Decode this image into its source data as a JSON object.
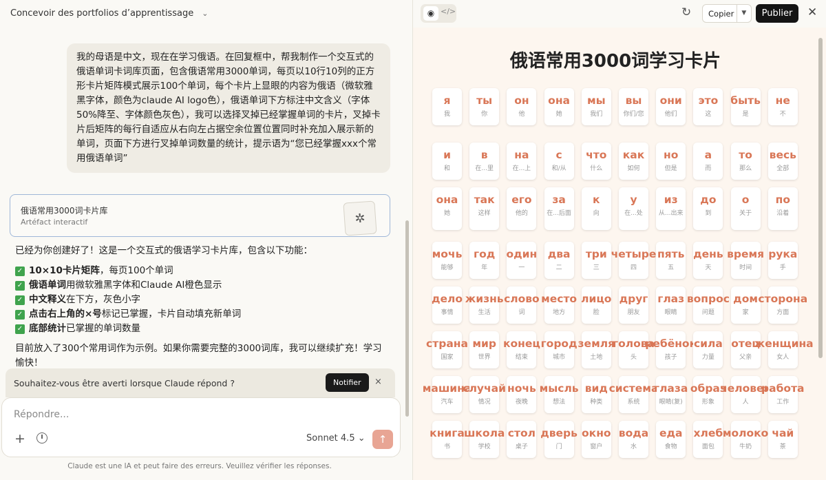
{
  "chat": {
    "title": "Concevoir des portfolios d’apprentissage",
    "user_message": "我的母语是中文，现在在学习俄语。在回复框中，帮我制作一个交互式的俄语单词卡词库页面，包含俄语常用3000单词，每页以10行10列的正方形卡片矩阵模式展示100个单词，每个卡片上显眼的内容为俄语（微软雅黑字体，颜色为claude AI logo色），俄语单词下方标注中文含义（字体50%降至、字体颜色灰色），我可以选择叉掉已经掌握单词的卡片，叉掉卡片后矩阵的每行自适应从右向左占据空余位置位置同时补充加入展示新的单词，页面下方进行叉掉单词数量的统计，提示语为“您已经掌握xxx个常用俄语单词”",
    "artifact": {
      "title": "俄语常用3000词卡片库",
      "subtitle": "Artéfact interactif"
    },
    "reply": {
      "intro": "已经为你创建好了！这是一个交互式的俄语学习卡片库，包含以下功能：",
      "features": [
        {
          "bold": "10×10卡片矩阵",
          "text": "，每页100个单词"
        },
        {
          "bold": "俄语单词",
          "text": "用微软雅黑字体和Claude AI橙色显示"
        },
        {
          "bold": "中文释义",
          "text": "在下方，灰色小字"
        },
        {
          "bold": "点击右上角的×号",
          "text": "标记已掌握，卡片自动填充新单词"
        },
        {
          "bold": "底部统计",
          "text": "已掌握的单词数量"
        }
      ],
      "tail": "目前放入了300个常用词作为示例。如果你需要完整的3000词库，我可以继续扩充！学习愉快！"
    },
    "notify": {
      "text": "Souhaitez-vous être averti lorsque Claude répond ?",
      "button": "Notifier",
      "close": "×"
    },
    "composer": {
      "placeholder": "Répondre...",
      "model": "Sonnet 4.5 ⌄",
      "send": "↑"
    },
    "disclaimer": "Claude est une IA et peut faire des erreurs. Veuillez vérifier les réponses."
  },
  "preview": {
    "copy_label": "Copier",
    "publish_label": "Publier",
    "title": "俄语常用3000词学习卡片",
    "accent_color": "#d97757",
    "rows": [
      [
        [
          "я",
          "我"
        ],
        [
          "ты",
          "你"
        ],
        [
          "он",
          "他"
        ],
        [
          "она",
          "她"
        ],
        [
          "мы",
          "我们"
        ],
        [
          "вы",
          "你们/您"
        ],
        [
          "они",
          "他们"
        ],
        [
          "это",
          "这"
        ],
        [
          "быть",
          "是"
        ],
        [
          "не",
          "不"
        ]
      ],
      [
        [
          "и",
          "和"
        ],
        [
          "в",
          "在...里"
        ],
        [
          "на",
          "在...上"
        ],
        [
          "с",
          "和/从"
        ],
        [
          "что",
          "什么"
        ],
        [
          "как",
          "如何"
        ],
        [
          "но",
          "但是"
        ],
        [
          "а",
          "而"
        ],
        [
          "то",
          "那么"
        ],
        [
          "весь",
          "全部"
        ]
      ],
      [
        [
          "она",
          "她"
        ],
        [
          "так",
          "这样"
        ],
        [
          "его",
          "他的"
        ],
        [
          "за",
          "在...后面"
        ],
        [
          "к",
          "向"
        ],
        [
          "у",
          "在...处"
        ],
        [
          "из",
          "从...出来"
        ],
        [
          "до",
          "到"
        ],
        [
          "о",
          "关于"
        ],
        [
          "по",
          "沿着"
        ]
      ],
      [
        [
          "мочь",
          "能够"
        ],
        [
          "год",
          "年"
        ],
        [
          "один",
          "一"
        ],
        [
          "два",
          "二"
        ],
        [
          "три",
          "三"
        ],
        [
          "четыре",
          "四"
        ],
        [
          "пять",
          "五"
        ],
        [
          "день",
          "天"
        ],
        [
          "время",
          "时间"
        ],
        [
          "рука",
          "手"
        ]
      ],
      [
        [
          "дело",
          "事情"
        ],
        [
          "жизнь",
          "生活"
        ],
        [
          "слово",
          "词"
        ],
        [
          "место",
          "地方"
        ],
        [
          "лицо",
          "脸"
        ],
        [
          "друг",
          "朋友"
        ],
        [
          "глаз",
          "眼睛"
        ],
        [
          "вопрос",
          "问题"
        ],
        [
          "дом",
          "家"
        ],
        [
          "сторона",
          "方面"
        ]
      ],
      [
        [
          "страна",
          "国家"
        ],
        [
          "мир",
          "世界"
        ],
        [
          "конец",
          "结束"
        ],
        [
          "город",
          "城市"
        ],
        [
          "земля",
          "土地"
        ],
        [
          "голова",
          "头"
        ],
        [
          "ребёнок",
          "孩子"
        ],
        [
          "сила",
          "力量"
        ],
        [
          "отец",
          "父亲"
        ],
        [
          "женщина",
          "女人"
        ]
      ],
      [
        [
          "машина",
          "汽车"
        ],
        [
          "случай",
          "情况"
        ],
        [
          "ночь",
          "夜晚"
        ],
        [
          "мысль",
          "想法"
        ],
        [
          "вид",
          "种类"
        ],
        [
          "система",
          "系统"
        ],
        [
          "глаза",
          "眼睛(复)"
        ],
        [
          "образ",
          "形象"
        ],
        [
          "человек",
          "人"
        ],
        [
          "работа",
          "工作"
        ]
      ],
      [
        [
          "книга",
          "书"
        ],
        [
          "школа",
          "学校"
        ],
        [
          "стол",
          "桌子"
        ],
        [
          "дверь",
          "门"
        ],
        [
          "окно",
          "窗户"
        ],
        [
          "вода",
          "水"
        ],
        [
          "еда",
          "食物"
        ],
        [
          "хлеб",
          "面包"
        ],
        [
          "молоко",
          "牛奶"
        ],
        [
          "чай",
          "茶"
        ]
      ]
    ]
  }
}
